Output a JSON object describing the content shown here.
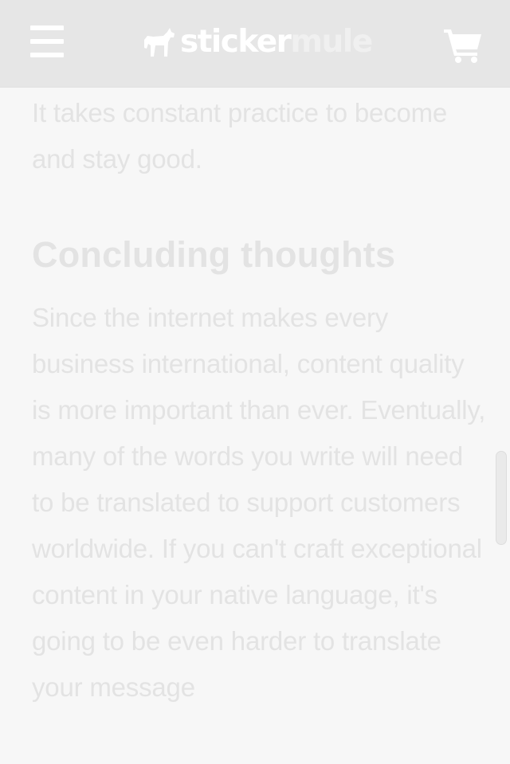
{
  "header": {
    "menu_icon": "hamburger-menu-icon",
    "logo": {
      "icon": "mule-icon",
      "word_sticker": "sticker",
      "word_mule": "mule"
    },
    "cart_icon": "shopping-cart-icon"
  },
  "article": {
    "intro_paragraph": "It takes constant practice to become and stay good.",
    "section_heading": "Concluding thoughts",
    "section_paragraph": "Since the internet makes every business international, content quality is more important than ever. Eventually, many of the words you write will need to be translated to support customers worldwide. If you can't craft exceptional content in your native language, it's going to be even harder to translate your message"
  },
  "colors": {
    "header_background": "#e6e6e6",
    "page_background": "#f7f7f7",
    "text": "#e3e3e3",
    "icons": "#ffffff"
  }
}
